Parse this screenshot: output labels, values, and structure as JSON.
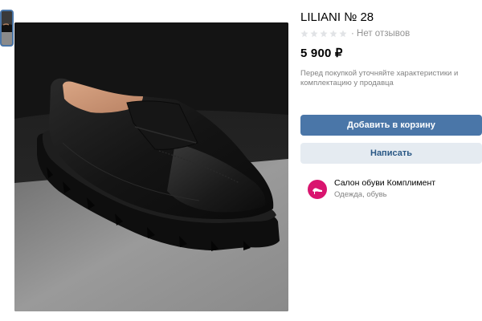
{
  "product": {
    "title": "LILIANI № 28",
    "rating_stars": 0,
    "rating_max": 5,
    "reviews_text": "· Нет отзывов",
    "price": "5 900 ₽",
    "note": "Перед покупкой уточняйте характеристики и комплектацию у продавца"
  },
  "actions": {
    "add_to_cart": "Добавить в корзину",
    "message": "Написать"
  },
  "shop": {
    "name": "Салон обуви Комплимент",
    "category": "Одежда, обувь"
  },
  "colors": {
    "primary": "#4a76a8",
    "secondary_bg": "#e5ebf1",
    "secondary_text": "#2a5885",
    "star_empty": "#e1e3e6",
    "shop_avatar": "#d9156f"
  }
}
